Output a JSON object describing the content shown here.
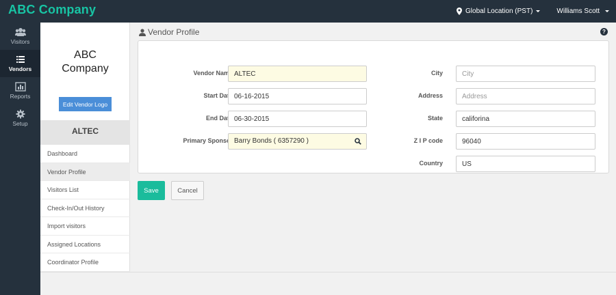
{
  "header": {
    "brand": "ABC Company",
    "location": "Global Location (PST)",
    "user": "Williams Scott"
  },
  "nav": {
    "items": [
      {
        "label": "Visitors",
        "icon": "users-icon"
      },
      {
        "label": "Vendors",
        "icon": "list-icon",
        "active": true
      },
      {
        "label": "Reports",
        "icon": "bar-chart-icon"
      },
      {
        "label": "Setup",
        "icon": "gear-icon"
      }
    ]
  },
  "panel": {
    "company_line1": "ABC",
    "company_line2": "Company",
    "logo_button": "Edit Vendor Logo",
    "vendor_name": "ALTEC",
    "menu": [
      "Dashboard",
      "Vendor Profile",
      "Visitors List",
      "Check-In/Out History",
      "Import visitors",
      "Assigned Locations",
      "Coordinator Profile"
    ],
    "active_menu": "Vendor Profile"
  },
  "profile": {
    "title": "Vendor Profile",
    "help": "?",
    "vendor_name": {
      "label": "Vendor Name",
      "value": "ALTEC"
    },
    "start_date": {
      "label": "Start Date",
      "value": "06-16-2015"
    },
    "end_date": {
      "label": "End Date",
      "value": "06-30-2015"
    },
    "primary_sponsor": {
      "label": "Primary Sponsor",
      "value": "Barry Bonds ( 6357290 )"
    },
    "city": {
      "label": "City",
      "value": "",
      "placeholder": "City"
    },
    "address": {
      "label": "Address",
      "value": "",
      "placeholder": "Address"
    },
    "state": {
      "label": "State",
      "value": "califorina"
    },
    "zip": {
      "label": "Z I P code",
      "value": "96040"
    },
    "country": {
      "label": "Country",
      "value": "US"
    }
  },
  "actions": {
    "save": "Save",
    "cancel": "Cancel"
  },
  "colors": {
    "topbar": "#25313d",
    "brand": "#18c4a4",
    "save": "#1abc9c",
    "logo_button": "#4a8ed8",
    "highlight_field": "#fdfbe3"
  }
}
